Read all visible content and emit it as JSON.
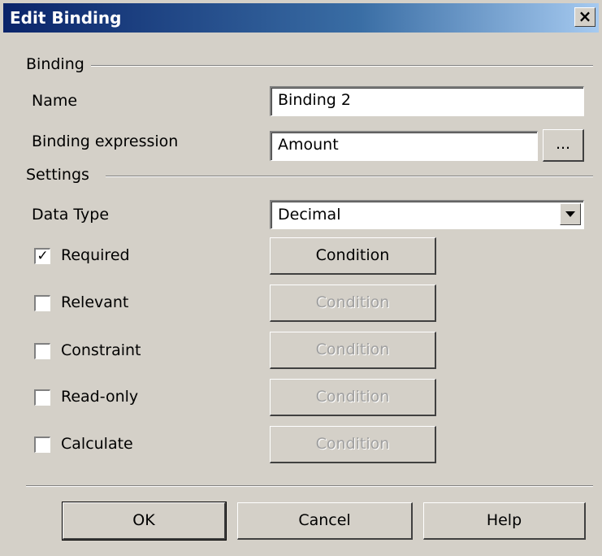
{
  "window": {
    "title": "Edit Binding",
    "close_glyph": "×"
  },
  "binding_group": {
    "label": "Binding",
    "name_label": "Name",
    "name_value": "Binding 2",
    "expression_label": "Binding expression",
    "expression_value": "Amount",
    "browse_label": "..."
  },
  "settings_group": {
    "label": "Settings",
    "data_type_label": "Data Type",
    "data_type_value": "Decimal",
    "rows": [
      {
        "label": "Required",
        "checked": true,
        "condition_label": "Condition",
        "condition_enabled": true
      },
      {
        "label": "Relevant",
        "checked": false,
        "condition_label": "Condition",
        "condition_enabled": false
      },
      {
        "label": "Constraint",
        "checked": false,
        "condition_label": "Condition",
        "condition_enabled": false
      },
      {
        "label": "Read-only",
        "checked": false,
        "condition_label": "Condition",
        "condition_enabled": false
      },
      {
        "label": "Calculate",
        "checked": false,
        "condition_label": "Condition",
        "condition_enabled": false
      }
    ]
  },
  "footer": {
    "ok_label": "OK",
    "cancel_label": "Cancel",
    "help_label": "Help"
  }
}
